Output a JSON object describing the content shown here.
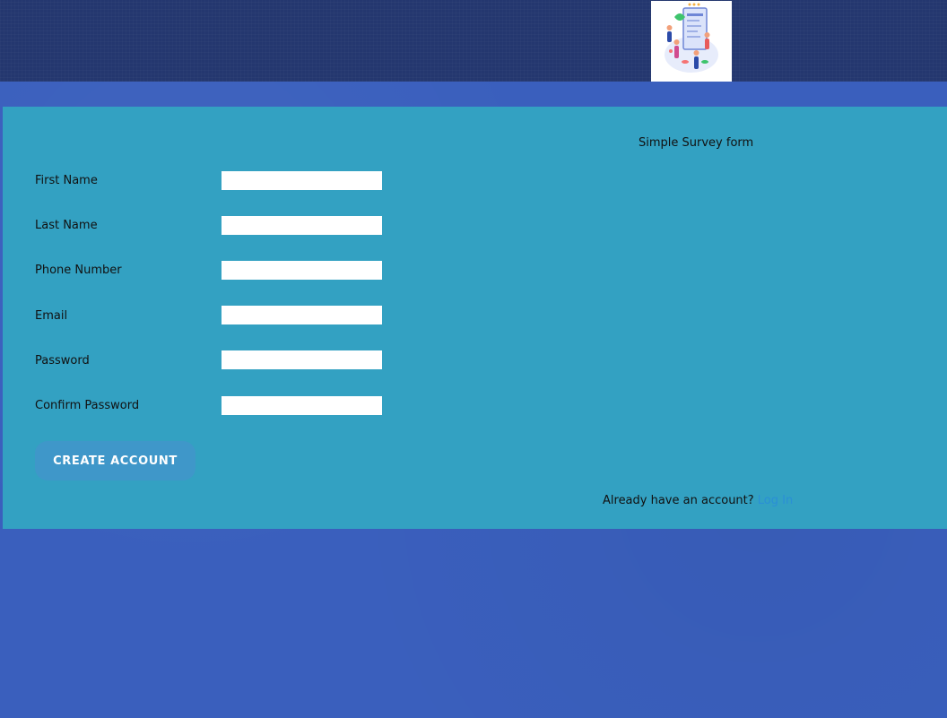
{
  "header": {
    "logo_icon": "survey-illustration-icon",
    "background_color": "#24376f"
  },
  "page": {
    "background_color": "#3a5fbd"
  },
  "form": {
    "title": "Simple Survey form",
    "background_color": "#33a1c2",
    "fields": [
      {
        "label": "First Name",
        "value": "",
        "type": "text"
      },
      {
        "label": "Last Name",
        "value": "",
        "type": "text"
      },
      {
        "label": "Phone Number",
        "value": "",
        "type": "tel"
      },
      {
        "label": "Email",
        "value": "",
        "type": "email"
      },
      {
        "label": "Password",
        "value": "",
        "type": "password"
      },
      {
        "label": "Confirm Password",
        "value": "",
        "type": "password"
      }
    ],
    "submit_label": "CREATE ACCOUNT",
    "footer_text": "Already have an account? ",
    "login_label": "Log In",
    "link_color": "#2a8fd6"
  }
}
